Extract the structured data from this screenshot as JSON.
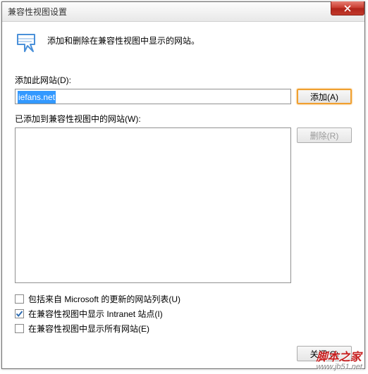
{
  "window": {
    "title": "兼容性视图设置"
  },
  "header": {
    "description": "添加和删除在兼容性视图中显示的网站。"
  },
  "addSection": {
    "label": "添加此网站(D):",
    "inputValue": "iefans.net",
    "addButton": "添加(A)"
  },
  "listSection": {
    "label": "已添加到兼容性视图中的网站(W):",
    "removeButton": "删除(R)",
    "items": []
  },
  "checkboxes": [
    {
      "label": "包括来自 Microsoft 的更新的网站列表(U)",
      "checked": false
    },
    {
      "label": "在兼容性视图中显示 Intranet 站点(I)",
      "checked": true
    },
    {
      "label": "在兼容性视图中显示所有网站(E)",
      "checked": false
    }
  ],
  "footer": {
    "closeButton": "关闭(C)"
  },
  "watermark": {
    "main": "脚本之家",
    "sub": "www.jb51.net"
  }
}
